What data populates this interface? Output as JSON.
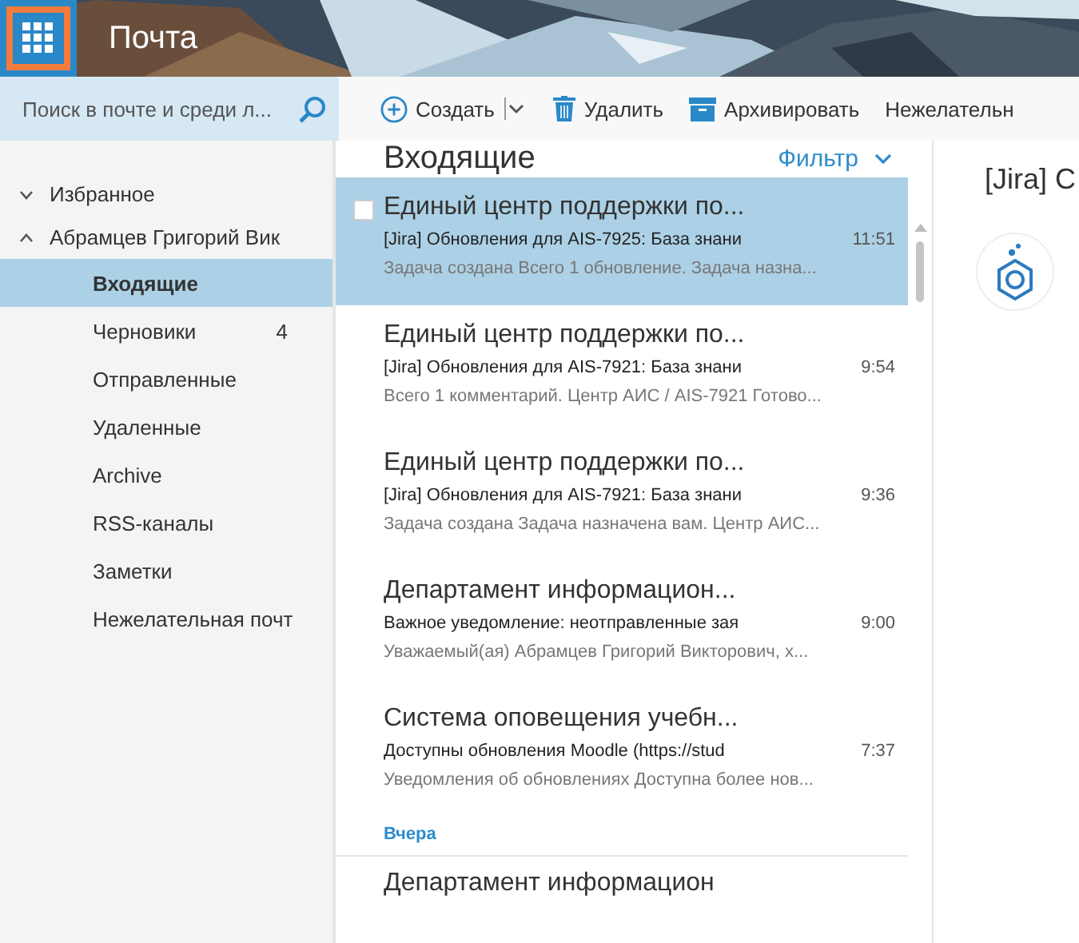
{
  "header": {
    "title": "Почта"
  },
  "search": {
    "placeholder": "Поиск в почте и среди л..."
  },
  "toolbar": [
    {
      "label": "Создать",
      "kind": "create"
    },
    {
      "label": "Удалить",
      "kind": "delete"
    },
    {
      "label": "Архивировать",
      "kind": "archive"
    },
    {
      "label": "Нежелательн",
      "kind": "plain"
    }
  ],
  "sidebar": {
    "groups": [
      {
        "label": "Избранное",
        "expanded": false
      },
      {
        "label": "Абрамцев Григорий Вик",
        "expanded": true
      }
    ],
    "folders": [
      {
        "label": "Входящие",
        "selected": true
      },
      {
        "label": "Черновики",
        "count": "4",
        "selected": false
      },
      {
        "label": "Отправленные",
        "selected": false
      },
      {
        "label": "Удаленные",
        "selected": false
      },
      {
        "label": "Archive",
        "selected": false
      },
      {
        "label": "RSS-каналы",
        "selected": false
      },
      {
        "label": "Заметки",
        "selected": false
      },
      {
        "label": "Нежелательная почт",
        "selected": false
      }
    ]
  },
  "message_list": {
    "title": "Входящие",
    "filter": "Фильтр",
    "messages": [
      {
        "sender": "Единый центр поддержки по...",
        "subject": "[Jira] Обновления для AIS-7925: База знани",
        "time": "11:51",
        "preview": "Задача создана Всего 1 обновление. Задача назна...",
        "selected": true
      },
      {
        "sender": "Единый центр поддержки по...",
        "subject": "[Jira] Обновления для AIS-7921: База знани",
        "time": "9:54",
        "preview": "Всего 1 комментарий. Центр АИС / AIS-7921 Готово...",
        "selected": false
      },
      {
        "sender": "Единый центр поддержки по...",
        "subject": "[Jira] Обновления для AIS-7921: База знани",
        "time": "9:36",
        "preview": "Задача создана Задача назначена вам. Центр АИС...",
        "selected": false
      },
      {
        "sender": "Департамент информацион...",
        "subject": "Важное уведомление: неотправленные зая",
        "time": "9:00",
        "preview": "Уважаемый(ая) Абрамцев Григорий Викторович, х...",
        "selected": false
      },
      {
        "sender": "Система оповещения учебн...",
        "subject": "Доступны обновления Moodle (https://stud",
        "time": "7:37",
        "preview": "Уведомления об обновлениях Доступна более нов...",
        "selected": false
      }
    ],
    "section": "Вчера",
    "next_sender": "Департамент информацион"
  },
  "reading_pane": {
    "title": "[Jira] C"
  }
}
